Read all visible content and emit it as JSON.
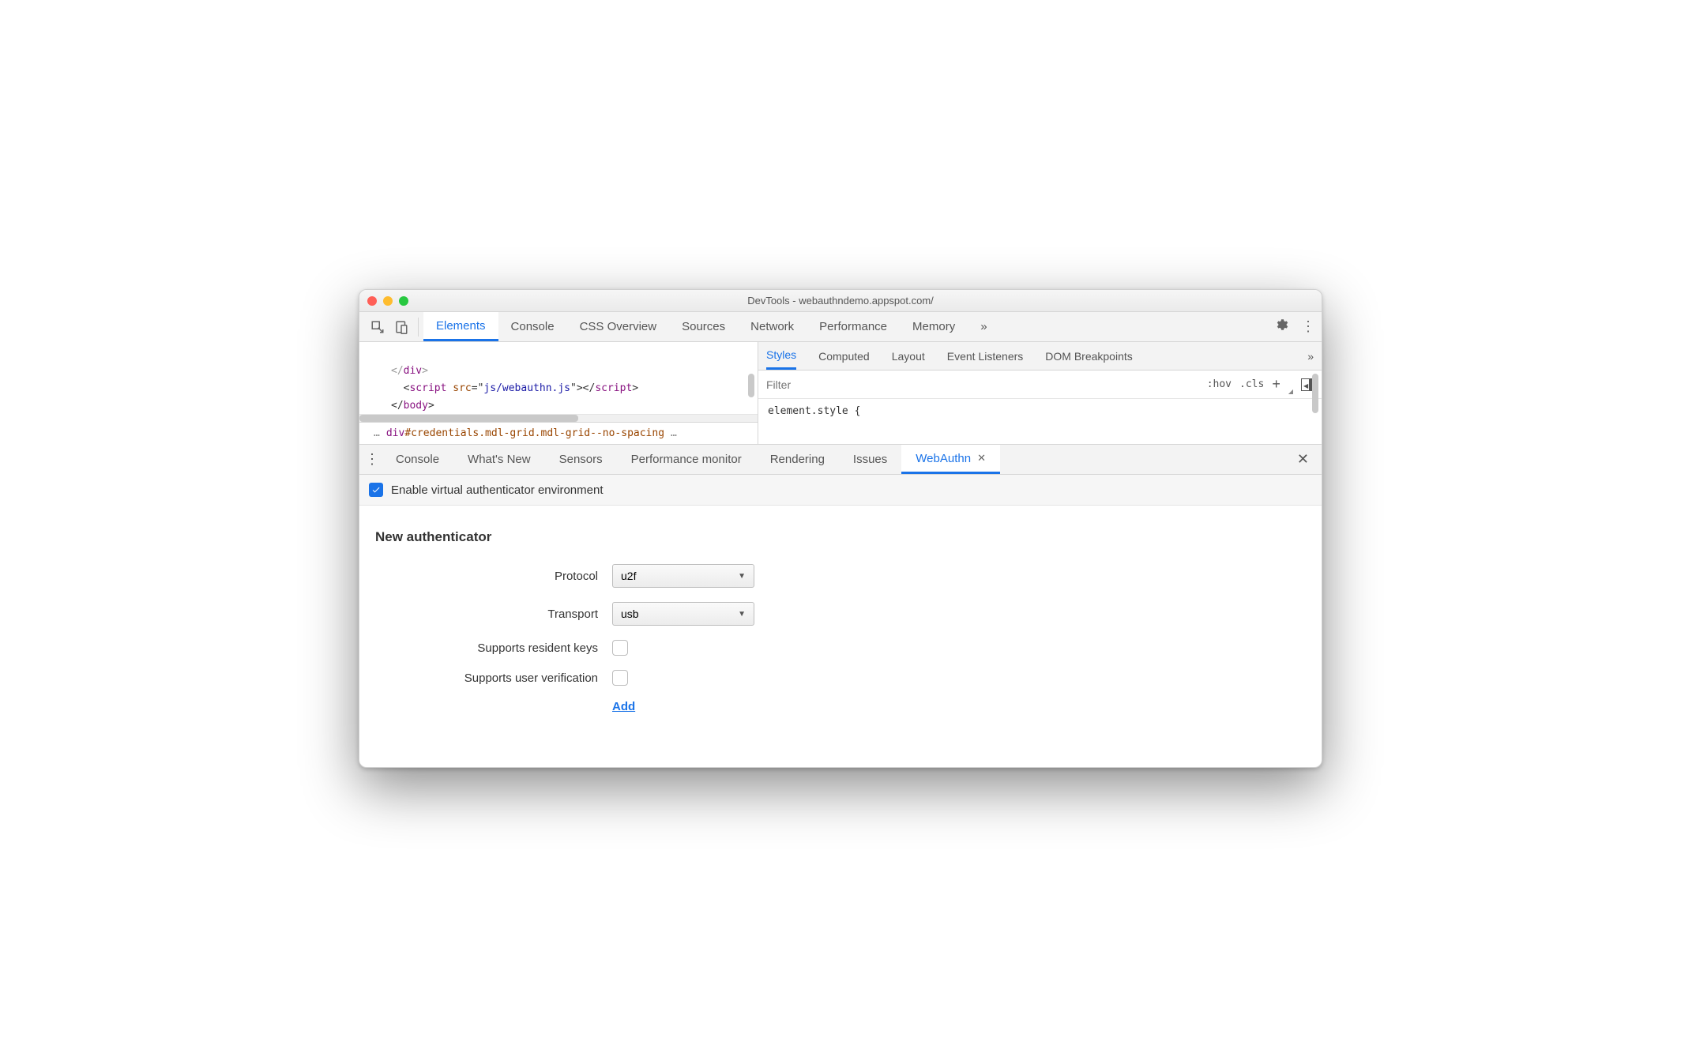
{
  "window": {
    "title": "DevTools - webauthndemo.appspot.com/"
  },
  "top_tabs": {
    "items": [
      "Elements",
      "Console",
      "CSS Overview",
      "Sources",
      "Network",
      "Performance",
      "Memory"
    ],
    "active_index": 0,
    "overflow": "»"
  },
  "code": {
    "line1_a": "</",
    "line1_b": "div",
    "line1_c": ">",
    "line2_a": "<",
    "line2_b": "script",
    "line2_c": " src",
    "line2_d": "=\"",
    "line2_e": "js/webauthn.js",
    "line2_f": "\">",
    "line2_g": "</",
    "line2_h": "script",
    "line2_i": ">",
    "line3_a": "</",
    "line3_b": "body",
    "line3_c": ">"
  },
  "breadcrumb": {
    "left_ell": "…",
    "main": "div",
    "id": "#credentials",
    "cls": ".mdl-grid.mdl-grid--no-spacing",
    "right_ell": "…"
  },
  "styles_tabs": {
    "items": [
      "Styles",
      "Computed",
      "Layout",
      "Event Listeners",
      "DOM Breakpoints"
    ],
    "active_index": 0,
    "overflow": "»"
  },
  "styles_filter": {
    "placeholder": "Filter",
    "hov": ":hov",
    "cls": ".cls",
    "plus": "+"
  },
  "styles_body": "element.style {",
  "drawer_tabs": {
    "items": [
      "Console",
      "What's New",
      "Sensors",
      "Performance monitor",
      "Rendering",
      "Issues",
      "WebAuthn"
    ],
    "active_index": 6
  },
  "enable": {
    "label": "Enable virtual authenticator environment",
    "checked": true
  },
  "form": {
    "title": "New authenticator",
    "protocol_label": "Protocol",
    "protocol_value": "u2f",
    "transport_label": "Transport",
    "transport_value": "usb",
    "resident_label": "Supports resident keys",
    "userverif_label": "Supports user verification",
    "add": "Add"
  }
}
